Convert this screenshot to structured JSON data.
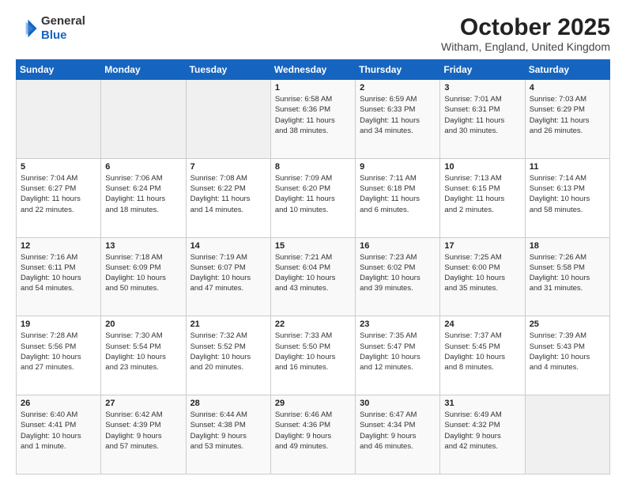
{
  "logo": {
    "general": "General",
    "blue": "Blue"
  },
  "header": {
    "month": "October 2025",
    "location": "Witham, England, United Kingdom"
  },
  "days_of_week": [
    "Sunday",
    "Monday",
    "Tuesday",
    "Wednesday",
    "Thursday",
    "Friday",
    "Saturday"
  ],
  "weeks": [
    [
      {
        "day": "",
        "info": ""
      },
      {
        "day": "",
        "info": ""
      },
      {
        "day": "",
        "info": ""
      },
      {
        "day": "1",
        "info": "Sunrise: 6:58 AM\nSunset: 6:36 PM\nDaylight: 11 hours\nand 38 minutes."
      },
      {
        "day": "2",
        "info": "Sunrise: 6:59 AM\nSunset: 6:33 PM\nDaylight: 11 hours\nand 34 minutes."
      },
      {
        "day": "3",
        "info": "Sunrise: 7:01 AM\nSunset: 6:31 PM\nDaylight: 11 hours\nand 30 minutes."
      },
      {
        "day": "4",
        "info": "Sunrise: 7:03 AM\nSunset: 6:29 PM\nDaylight: 11 hours\nand 26 minutes."
      }
    ],
    [
      {
        "day": "5",
        "info": "Sunrise: 7:04 AM\nSunset: 6:27 PM\nDaylight: 11 hours\nand 22 minutes."
      },
      {
        "day": "6",
        "info": "Sunrise: 7:06 AM\nSunset: 6:24 PM\nDaylight: 11 hours\nand 18 minutes."
      },
      {
        "day": "7",
        "info": "Sunrise: 7:08 AM\nSunset: 6:22 PM\nDaylight: 11 hours\nand 14 minutes."
      },
      {
        "day": "8",
        "info": "Sunrise: 7:09 AM\nSunset: 6:20 PM\nDaylight: 11 hours\nand 10 minutes."
      },
      {
        "day": "9",
        "info": "Sunrise: 7:11 AM\nSunset: 6:18 PM\nDaylight: 11 hours\nand 6 minutes."
      },
      {
        "day": "10",
        "info": "Sunrise: 7:13 AM\nSunset: 6:15 PM\nDaylight: 11 hours\nand 2 minutes."
      },
      {
        "day": "11",
        "info": "Sunrise: 7:14 AM\nSunset: 6:13 PM\nDaylight: 10 hours\nand 58 minutes."
      }
    ],
    [
      {
        "day": "12",
        "info": "Sunrise: 7:16 AM\nSunset: 6:11 PM\nDaylight: 10 hours\nand 54 minutes."
      },
      {
        "day": "13",
        "info": "Sunrise: 7:18 AM\nSunset: 6:09 PM\nDaylight: 10 hours\nand 50 minutes."
      },
      {
        "day": "14",
        "info": "Sunrise: 7:19 AM\nSunset: 6:07 PM\nDaylight: 10 hours\nand 47 minutes."
      },
      {
        "day": "15",
        "info": "Sunrise: 7:21 AM\nSunset: 6:04 PM\nDaylight: 10 hours\nand 43 minutes."
      },
      {
        "day": "16",
        "info": "Sunrise: 7:23 AM\nSunset: 6:02 PM\nDaylight: 10 hours\nand 39 minutes."
      },
      {
        "day": "17",
        "info": "Sunrise: 7:25 AM\nSunset: 6:00 PM\nDaylight: 10 hours\nand 35 minutes."
      },
      {
        "day": "18",
        "info": "Sunrise: 7:26 AM\nSunset: 5:58 PM\nDaylight: 10 hours\nand 31 minutes."
      }
    ],
    [
      {
        "day": "19",
        "info": "Sunrise: 7:28 AM\nSunset: 5:56 PM\nDaylight: 10 hours\nand 27 minutes."
      },
      {
        "day": "20",
        "info": "Sunrise: 7:30 AM\nSunset: 5:54 PM\nDaylight: 10 hours\nand 23 minutes."
      },
      {
        "day": "21",
        "info": "Sunrise: 7:32 AM\nSunset: 5:52 PM\nDaylight: 10 hours\nand 20 minutes."
      },
      {
        "day": "22",
        "info": "Sunrise: 7:33 AM\nSunset: 5:50 PM\nDaylight: 10 hours\nand 16 minutes."
      },
      {
        "day": "23",
        "info": "Sunrise: 7:35 AM\nSunset: 5:47 PM\nDaylight: 10 hours\nand 12 minutes."
      },
      {
        "day": "24",
        "info": "Sunrise: 7:37 AM\nSunset: 5:45 PM\nDaylight: 10 hours\nand 8 minutes."
      },
      {
        "day": "25",
        "info": "Sunrise: 7:39 AM\nSunset: 5:43 PM\nDaylight: 10 hours\nand 4 minutes."
      }
    ],
    [
      {
        "day": "26",
        "info": "Sunrise: 6:40 AM\nSunset: 4:41 PM\nDaylight: 10 hours\nand 1 minute."
      },
      {
        "day": "27",
        "info": "Sunrise: 6:42 AM\nSunset: 4:39 PM\nDaylight: 9 hours\nand 57 minutes."
      },
      {
        "day": "28",
        "info": "Sunrise: 6:44 AM\nSunset: 4:38 PM\nDaylight: 9 hours\nand 53 minutes."
      },
      {
        "day": "29",
        "info": "Sunrise: 6:46 AM\nSunset: 4:36 PM\nDaylight: 9 hours\nand 49 minutes."
      },
      {
        "day": "30",
        "info": "Sunrise: 6:47 AM\nSunset: 4:34 PM\nDaylight: 9 hours\nand 46 minutes."
      },
      {
        "day": "31",
        "info": "Sunrise: 6:49 AM\nSunset: 4:32 PM\nDaylight: 9 hours\nand 42 minutes."
      },
      {
        "day": "",
        "info": ""
      }
    ]
  ]
}
